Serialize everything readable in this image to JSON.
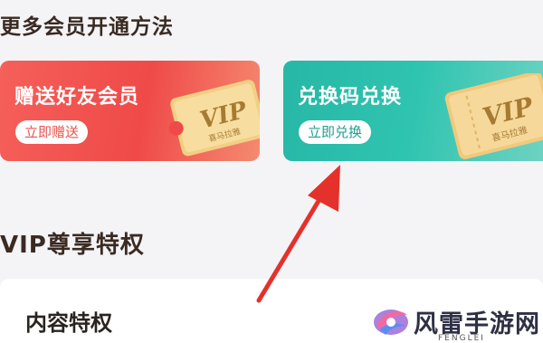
{
  "sections": {
    "more_methods_title": "更多会员开通方法",
    "vip_privileges_title": "VIP尊享特权"
  },
  "cards": {
    "gift": {
      "label": "赠送好友会员",
      "button": "立即赠送",
      "ticket_text": "VIP",
      "ticket_sub": "喜马拉雅"
    },
    "redeem": {
      "label": "兑换码兑换",
      "button": "立即兑换",
      "ticket_text": "VIP",
      "ticket_sub": "喜马拉雅"
    }
  },
  "content": {
    "title": "内容特权"
  },
  "watermark": {
    "name": "风雷手游网",
    "sub": "FENGLEI"
  },
  "colors": {
    "gift_card": "#ef4a48",
    "redeem_card": "#2fc4b0",
    "arrow": "#e5312b",
    "title_text": "#3a2a22"
  },
  "icons": [
    "ticket-icon",
    "arrow-annotation",
    "watermark-logo-icon"
  ]
}
